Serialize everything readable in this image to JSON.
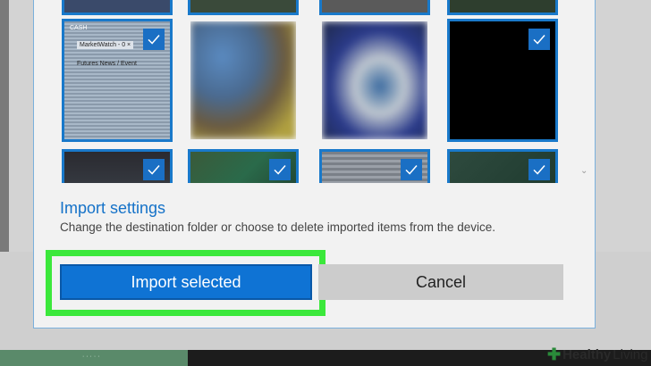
{
  "dialog": {
    "settings_title": "Import settings",
    "settings_description": "Change the destination folder or choose to delete imported items from the device.",
    "import_button": "Import selected",
    "cancel_button": "Cancel"
  },
  "thumbnails": {
    "spreadsheet_lines": [
      "CASH",
      "MarketWatch - 0  ×",
      "Futures   News / Event"
    ],
    "checked": [
      true,
      false,
      false,
      true,
      true,
      true,
      true,
      true
    ]
  },
  "watermark": {
    "brand": "Healthy",
    "brand_suffix": "Living"
  },
  "colors": {
    "accent": "#0f73d4",
    "highlight": "#3be83b",
    "selection_border": "#1979ca"
  }
}
